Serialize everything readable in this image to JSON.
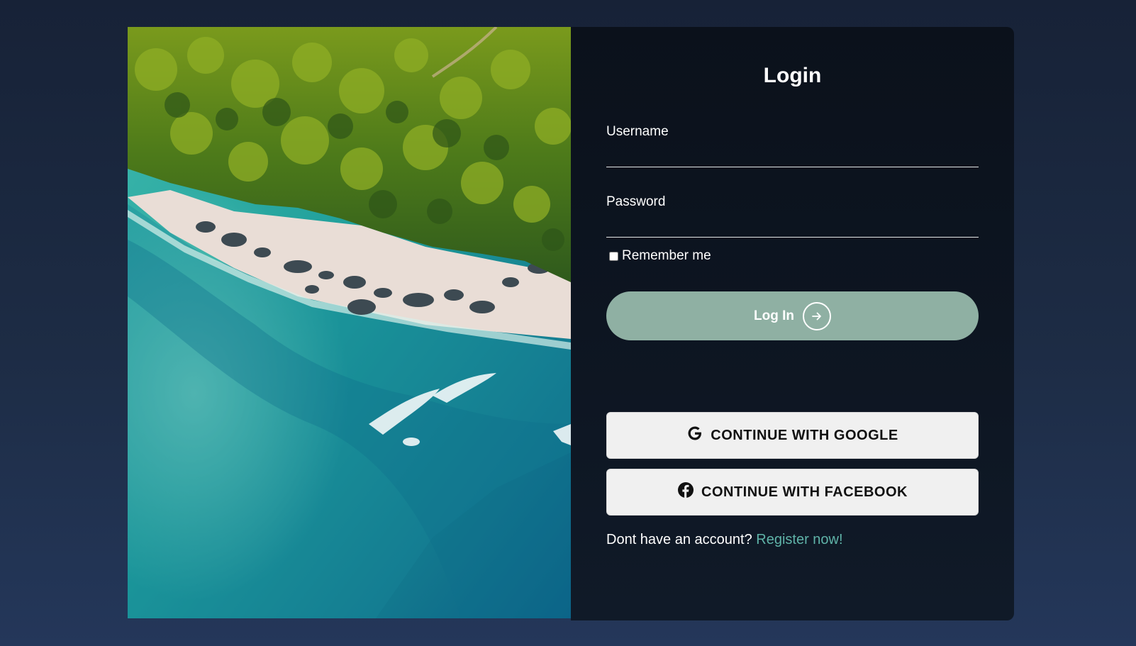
{
  "login": {
    "title": "Login",
    "username_label": "Username",
    "username_value": "",
    "password_label": "Password",
    "password_value": "",
    "remember_label": "Remember me",
    "remember_checked": false,
    "submit_label": "Log In",
    "submit_icon": "arrow-right-circle-icon"
  },
  "social": {
    "google_label": "CONTINUE WITH GOOGLE",
    "google_icon": "google-icon",
    "facebook_label": "CONTINUE WITH FACEBOOK",
    "facebook_icon": "facebook-icon"
  },
  "signup": {
    "prompt": "Dont have an account?",
    "link_label": "Register now!"
  },
  "colors": {
    "page_background": "#1d2c45",
    "panel_background": "#0d1521",
    "login_button": "#8fb0a3",
    "link": "#5fb3a8",
    "social_button": "#f0f0f0"
  }
}
